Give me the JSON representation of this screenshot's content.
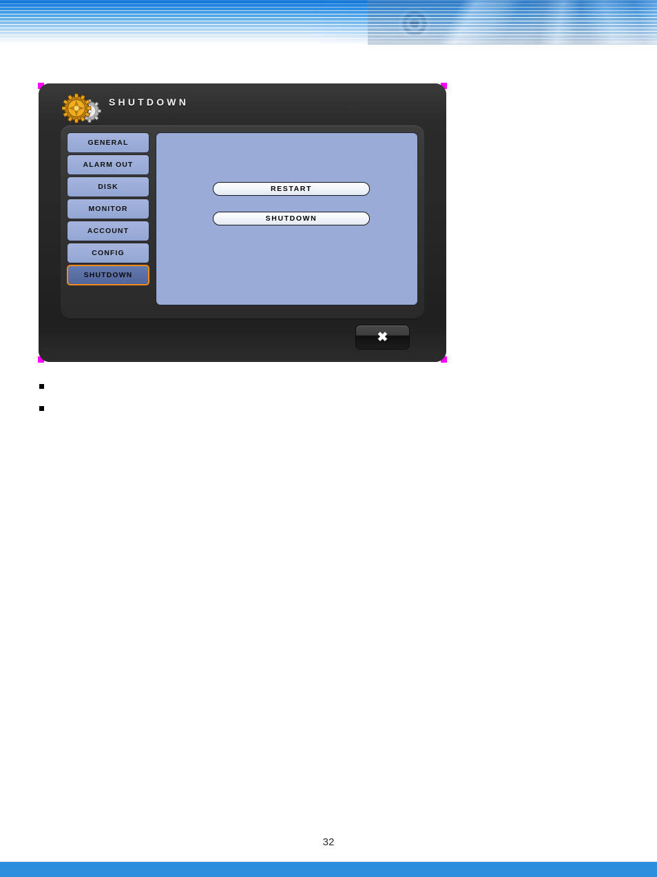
{
  "header": {
    "banner_icon": "banner-photo-montage",
    "accent_color": "#1878d8"
  },
  "dialog": {
    "title": "SHUTDOWN",
    "icon": "gear-icon",
    "selected_tab": "SHUTDOWN",
    "selected_border_color": "#f08a1c",
    "panel_color": "#9aabd8",
    "corner_accent_color": "#ff00ff",
    "tabs": [
      {
        "label": "GENERAL",
        "selected": false
      },
      {
        "label": "ALARM OUT",
        "selected": false
      },
      {
        "label": "DISK",
        "selected": false
      },
      {
        "label": "MONITOR",
        "selected": false
      },
      {
        "label": "ACCOUNT",
        "selected": false
      },
      {
        "label": "CONFIG",
        "selected": false
      },
      {
        "label": "SHUTDOWN",
        "selected": true
      }
    ],
    "actions": [
      {
        "label": "RESTART"
      },
      {
        "label": "SHUTDOWN"
      }
    ],
    "close_button": {
      "icon": "close-x-icon",
      "glyph": "✖"
    }
  },
  "bullets": [
    {
      "text": ""
    },
    {
      "text": ""
    }
  ],
  "footer": {
    "page_number": "32",
    "bar_color": "#2b8fe0"
  }
}
